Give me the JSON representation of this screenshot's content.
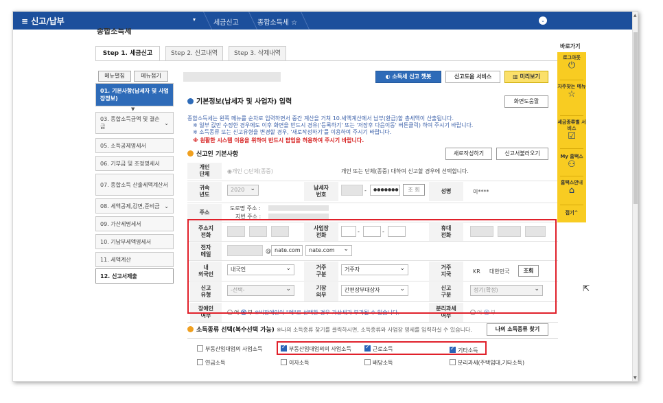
{
  "topbar": {
    "menu_title": "≡ 신고/납부",
    "dropdown": "▾",
    "crumb1": "세금신고",
    "crumb2": "종합소득세 ☆"
  },
  "page": {
    "title": "종합소득세"
  },
  "tabs": [
    {
      "label": "Step 1. 세금신고",
      "active": true
    },
    {
      "label": "Step 2. 신고내역",
      "active": false
    },
    {
      "label": "Step 3. 삭제내역",
      "active": false
    }
  ],
  "sidebar": {
    "open_all": "메뉴펼침",
    "close_all": "메뉴접기",
    "items": [
      {
        "label": "01. 기본사항(납세자 및 사업장정보)",
        "state": "hl"
      },
      {
        "label": "03. 종합소득금액 및 결손금",
        "state": ""
      },
      {
        "label": "05. 소득공제명세서",
        "state": ""
      },
      {
        "label": "06. 기부금 및 조정명세서",
        "state": ""
      },
      {
        "label": "07. 종합소득 산출세액계산서",
        "state": ""
      },
      {
        "label": "08. 세액공제,감면,준비금",
        "state": ""
      },
      {
        "label": "09. 가산세명세서",
        "state": ""
      },
      {
        "label": "10. 기납부세액명세서",
        "state": ""
      },
      {
        "label": "11. 세액계산",
        "state": ""
      },
      {
        "label": "12. 신고서제출",
        "state": "cur"
      }
    ]
  },
  "header_buttons": {
    "chatbot": "소득세 신고 챗봇",
    "help_service": "신고도움 서비스",
    "preview": "미리보기",
    "screen_help": "화면도움말"
  },
  "section": {
    "title": "기본정보(납세자 및 사업자) 입력",
    "desc1": "종합소득세는 왼쪽 메뉴를 순차로 입력하면서 중간 계산을 거쳐 10.세액계산에서 납부(환급)할 총세액이 산출됩니다.",
    "desc2": "※ 일부 값만 수정한 경우에도 이후 화면을 반드시 경유('등록하기' 또는 '저장후 다음이동' 버튼클릭) 하여 주시기 바랍니다.",
    "desc3": "※ 소득종류 또는 신고유형을 변경할 경우, '새로작성하기'를 이용하여 주시기 바랍니다.",
    "warn": "※ 원활한 시스템 이용을 위하여 반드시 팝업을 허용하여 주시기 바랍니다.",
    "subtitle": "신고인 기본사항",
    "new_write": "새로작성하기",
    "load": "신고서불러오기"
  },
  "form": {
    "individual_label": "개인\n단체",
    "individual_opts": "◉개인 ○단체(종중)",
    "individual_note": "개인 또는 단체(종중) 대하여 신고할 경우에 선택합니다.",
    "year_label": "귀속\n년도",
    "year_value": "2020",
    "taxno_label": "납세자\n번호",
    "taxno_dash": "-",
    "taxno_mask": "●●●●●●●",
    "lookup": "조 회",
    "name_label": "성명",
    "name_value": "이****",
    "addr_label": "주소",
    "addr_road": "도로명 주소 :",
    "addr_lot": "지번 주소 :",
    "home_tel_label": "주소지\n전화",
    "biz_tel_label": "사업장\n전화",
    "dash": "-",
    "mobile_label": "휴대\n전화",
    "email_label": "전자\n메일",
    "email_at": "@",
    "email_domain": "nate.com",
    "email_select": "nate.com",
    "nation_label": "내\n외국인",
    "nation_value": "내국인",
    "residence_label": "거주\n구분",
    "residence_value": "거주자",
    "country_label": "거주\n지국",
    "country_code": "KR",
    "country_name": "대한민국",
    "country_btn": "조회",
    "report_type_label": "신고\n유형",
    "report_type_value": "-선택-",
    "book_label": "기장\n의무",
    "book_value": "간편장부대상자",
    "report_cat_label": "신고\n구분",
    "report_cat_value": "정기(확정)",
    "disabled_label": "장애인\n여부",
    "disabled_no": "여",
    "disabled_yes": "부",
    "disabled_note": "※비장애인이 \"예\"로 선택한 경우 가산세가 부과될 수 있습니다.",
    "separate_label": "분리과세\n여부",
    "separate_no": "여",
    "separate_yes": "부"
  },
  "income": {
    "subtitle": "소득종류 선택(복수선택 가능)",
    "note": "※나의 소득종류 찾기를 클릭하시면, 소득종류와 사업장 명세를 입력하실 수 있습니다.",
    "find_btn": "나의 소득종류 찾기",
    "kinds": [
      {
        "label": "부동산임대업의 사업소득",
        "checked": false
      },
      {
        "label": "부동산임대업외의 사업소득",
        "checked": true
      },
      {
        "label": "근로소득",
        "checked": true
      },
      {
        "label": "기타소득",
        "checked": true
      },
      {
        "label": "연금소득",
        "checked": false
      },
      {
        "label": "이자소득",
        "checked": false
      },
      {
        "label": "배당소득",
        "checked": false
      },
      {
        "label": "분리과세(주택임대,기타소득)",
        "checked": false
      }
    ]
  },
  "quick": {
    "header": "바로가기",
    "logout": "로그아웃",
    "faq": "자주찾는 메뉴",
    "tax_service": "세금종류별 서비스",
    "my_hometax": "My 홈택스",
    "guide": "홈택스안내",
    "fold": "접기^"
  },
  "colors": {
    "topbar": "#1c4f9c",
    "accent": "#2e6bb8",
    "highlight": "#e0202a",
    "quick": "#f8cc22"
  }
}
